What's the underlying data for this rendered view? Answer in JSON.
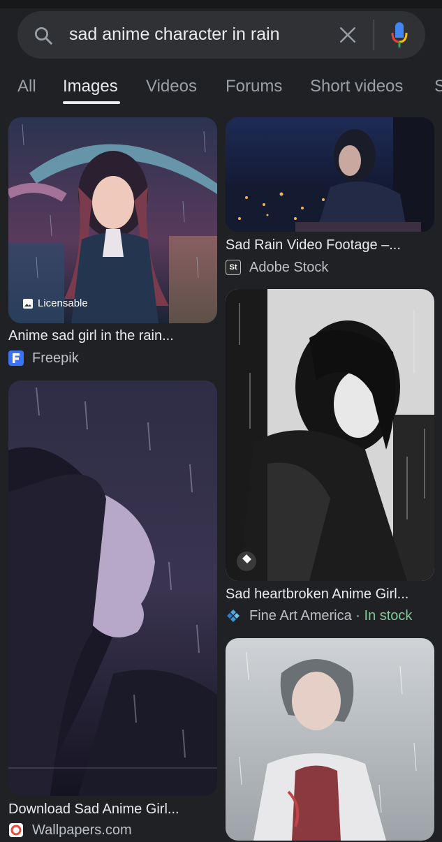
{
  "search": {
    "query": "sad anime character in rain"
  },
  "tabs": [
    "All",
    "Images",
    "Videos",
    "Forums",
    "Short videos",
    "S"
  ],
  "active_tab": "Images",
  "results": [
    {
      "title": "Anime sad girl in the rain...",
      "source": "Freepik",
      "badge": "Licensable"
    },
    {
      "title": "Sad Rain Video Footage –...",
      "source": "Adobe Stock"
    },
    {
      "title": "Sad heartbroken Anime Girl...",
      "source": "Fine Art America",
      "stock_sep": "·",
      "stock": "In stock"
    },
    {
      "title": "Download Sad Anime Girl...",
      "source": "Wallpapers.com"
    }
  ],
  "colors": {
    "background": "#202124",
    "search_bar": "#303134",
    "in_stock": "#81c995"
  }
}
